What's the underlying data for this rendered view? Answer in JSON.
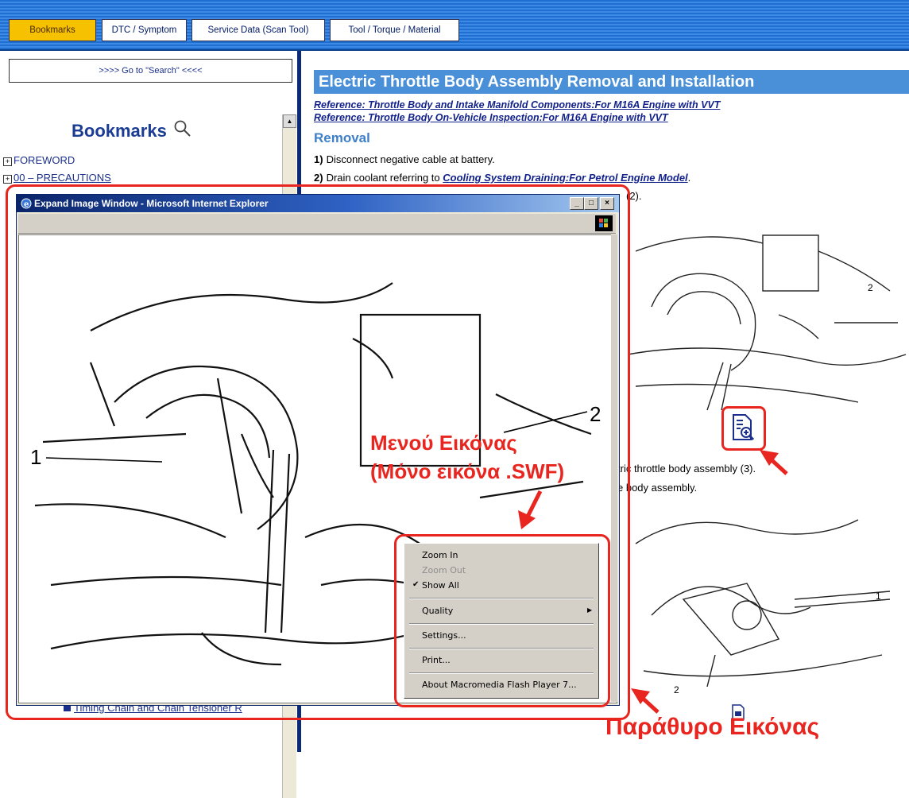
{
  "tabs": [
    {
      "label": "Bookmarks",
      "active": true
    },
    {
      "label": "DTC / Symptom",
      "active": false
    },
    {
      "label": "Service Data (Scan Tool)",
      "active": false
    },
    {
      "label": "Tool / Torque / Material",
      "active": false
    }
  ],
  "left": {
    "goto_search": ">>>> Go to \"Search\" <<<<",
    "heading": "Bookmarks",
    "items": [
      "FOREWORD",
      "00 – PRECAUTIONS"
    ],
    "bottom_item": "Timing Chain and Chain Tensioner R"
  },
  "main": {
    "title": "Electric Throttle Body Assembly Removal and Installation",
    "refs": [
      "Reference: Throttle Body and Intake Manifold Components:For M16A Engine with VVT",
      "Reference: Throttle Body On-Vehicle Inspection:For M16A Engine with VVT"
    ],
    "removal_heading": "Removal",
    "steps": [
      {
        "num": "1)",
        "text": "Disconnect negative cable at battery."
      },
      {
        "num": "2)",
        "text": "Drain coolant referring to ",
        "link": "Cooling System Draining:For Petrol Engine Model",
        "tail": "."
      }
    ],
    "step3_fragment": "(2).",
    "step4_fragment": "tric throttle body assembly (3).",
    "step5_fragment": "e body assembly.",
    "figure_labels": {
      "top_2": "2",
      "bottom_1": "1",
      "bottom_2": "2"
    }
  },
  "popup": {
    "title": "Expand Image Window - Microsoft Internet Explorer",
    "buttons": {
      "minimize": "_",
      "maximize": "□",
      "close": "×"
    },
    "figure_labels": {
      "label_1": "1",
      "label_2": "2"
    }
  },
  "context_menu": {
    "items": [
      {
        "label": "Zoom In",
        "enabled": true
      },
      {
        "label": "Zoom Out",
        "enabled": false
      },
      {
        "label": "Show All",
        "enabled": true,
        "checked": true
      },
      {
        "label": "Quality",
        "enabled": true,
        "submenu": true
      },
      {
        "label": "Settings...",
        "enabled": true
      },
      {
        "label": "Print...",
        "enabled": true
      },
      {
        "label": "About Macromedia Flash Player 7...",
        "enabled": true
      }
    ]
  },
  "annotations": {
    "menu_line1": "Μενού Εικόνας",
    "menu_line2": "(Μόνο εικόνα .SWF)",
    "window_label": "Παράθυρο Εικόνας"
  },
  "colors": {
    "annotation_red": "#e8251f",
    "tab_active": "#f5c100",
    "title_blue": "#4a90d9",
    "link_blue": "#12228a"
  },
  "icons": [
    "search-icon",
    "zoom-image-icon",
    "ie-icon",
    "windows-flag-icon",
    "check-icon",
    "submenu-arrow-icon",
    "page-icon"
  ]
}
